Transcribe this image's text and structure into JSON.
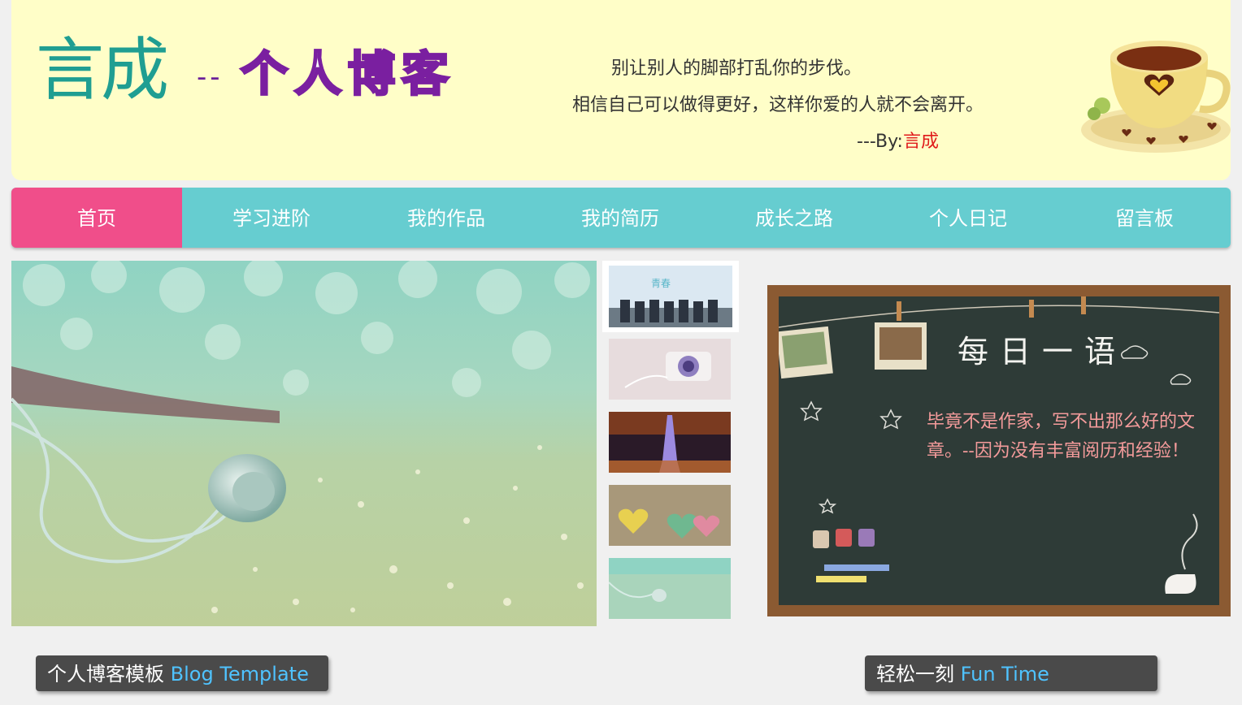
{
  "header": {
    "logo_main": "言成",
    "logo_dash": "--",
    "logo_sub": "个人博客",
    "motto_line1": "别让别人的脚部打乱你的步伐。",
    "motto_line2": "相信自己可以做得更好，这样你爱的人就不会离开。",
    "motto_by_prefix": "---By:",
    "motto_by_name": "言成"
  },
  "nav": {
    "items": [
      {
        "label": "首页",
        "active": true
      },
      {
        "label": "学习进阶"
      },
      {
        "label": "我的作品"
      },
      {
        "label": "我的简历"
      },
      {
        "label": "成长之路"
      },
      {
        "label": "个人日记"
      },
      {
        "label": "留言板"
      }
    ]
  },
  "board": {
    "title": "每日一语",
    "text": "毕竟不是作家，写不出那么好的文章。--因为没有丰富阅历和经验！"
  },
  "sections": {
    "left_cn": "个人博客模板 ",
    "left_en": "Blog Template",
    "right_cn": "轻松一刻 ",
    "right_en": "Fun Time"
  },
  "colors": {
    "header_bg": "#fffec8",
    "nav_bg": "#66cdd0",
    "nav_active": "#f04e8a",
    "logo_teal": "#1f9e92",
    "logo_purple": "#7a1fa0",
    "name_red": "#e01b1b",
    "section_en": "#4fc3ff"
  }
}
